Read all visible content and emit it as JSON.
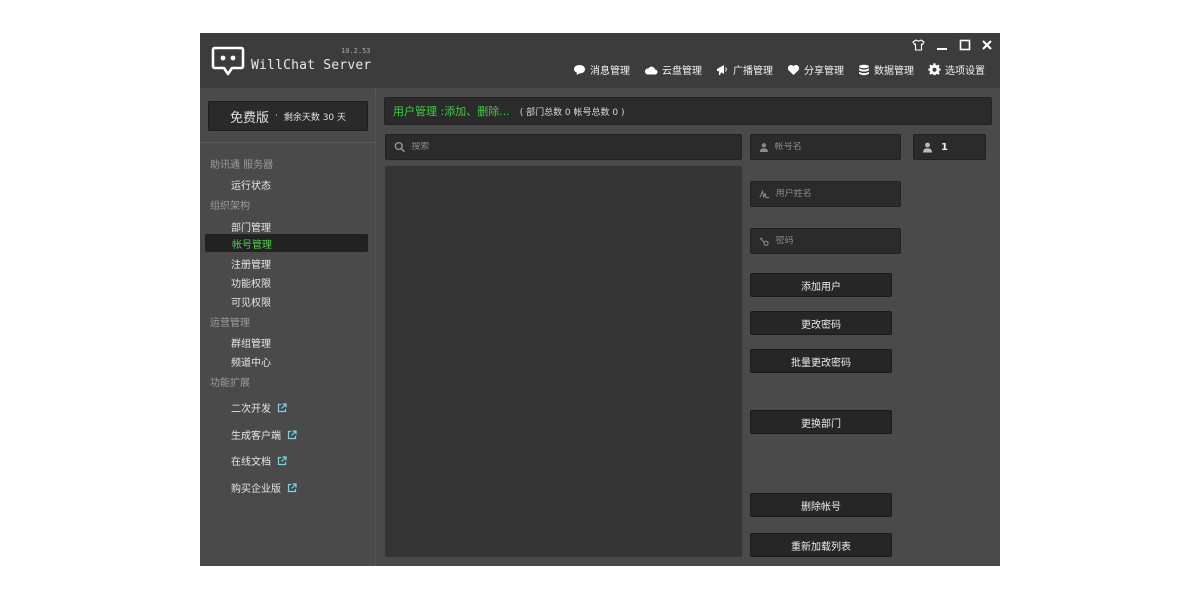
{
  "app": {
    "title": "WillChat Server",
    "version": "10.2.53",
    "accent_green": "#3ecf3e",
    "window_controls": [
      "skin-icon",
      "minimize-icon",
      "maximize-icon",
      "close-icon"
    ]
  },
  "topnav": {
    "items": [
      {
        "label": "消息管理",
        "icon": "chat-bubble-icon"
      },
      {
        "label": "云盘管理",
        "icon": "cloud-icon"
      },
      {
        "label": "广播管理",
        "icon": "megaphone-icon"
      },
      {
        "label": "分享管理",
        "icon": "heart-icon"
      },
      {
        "label": "数据管理",
        "icon": "database-icon"
      },
      {
        "label": "选项设置",
        "icon": "gear-icon"
      }
    ]
  },
  "sidebar": {
    "edition": {
      "name": "免费版",
      "dot": "·",
      "remaining": "剩余天数 30 天"
    },
    "groups": [
      {
        "label": "助讯通 服务器",
        "items": [
          {
            "label": "运行状态"
          }
        ]
      },
      {
        "label": "组织架构",
        "items": [
          {
            "label": "部门管理"
          },
          {
            "label": "帐号管理",
            "active": true
          },
          {
            "label": "注册管理"
          },
          {
            "label": "功能权限"
          },
          {
            "label": "可见权限"
          }
        ]
      },
      {
        "label": "运营管理",
        "items": [
          {
            "label": "群组管理"
          },
          {
            "label": "频道中心"
          }
        ]
      },
      {
        "label": "功能扩展",
        "items": [
          {
            "label": "二次开发",
            "external": true
          },
          {
            "label": "生成客户端",
            "external": true
          },
          {
            "label": "在线文档",
            "external": true
          },
          {
            "label": "购买企业版",
            "external": true
          }
        ]
      }
    ]
  },
  "main": {
    "header_title": "用户管理 :添加、删除...",
    "header_stats": "( 部门总数 0 帐号总数 0 )",
    "search_placeholder": "搜索",
    "account_placeholder": "帐号名",
    "fullname_placeholder": "用户姓名",
    "password_placeholder": "密码",
    "id_value": "1",
    "buttons": {
      "add_user": "添加用户",
      "change_password": "更改密码",
      "batch_change_password": "批量更改密码",
      "change_department": "更换部门",
      "delete_account": "删除帐号",
      "reload_list": "重新加载列表"
    }
  }
}
